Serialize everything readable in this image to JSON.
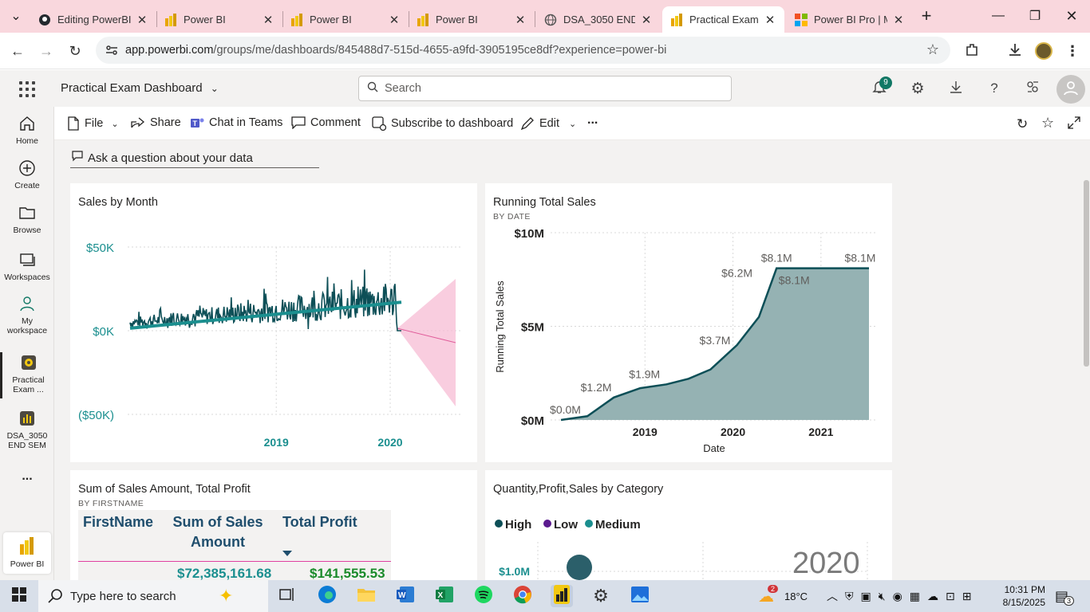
{
  "browser": {
    "tabs": [
      {
        "title": "Editing PowerBI_",
        "icon": "github-icon"
      },
      {
        "title": "Power BI",
        "icon": "powerbi-icon"
      },
      {
        "title": "Power BI",
        "icon": "powerbi-icon"
      },
      {
        "title": "Power BI",
        "icon": "powerbi-icon"
      },
      {
        "title": "DSA_3050 END S",
        "icon": "globe-icon"
      },
      {
        "title": "Practical Exam D",
        "icon": "powerbi-icon",
        "active": true
      },
      {
        "title": "Power BI Pro | M",
        "icon": "microsoft-icon"
      }
    ],
    "url_host": "app.powerbi.com",
    "url_path": "/groups/me/dashboards/845488d7-515d-4655-a9fd-3905195ce8df?experience=power-bi"
  },
  "header": {
    "dashboard_name": "Practical Exam Dashboard",
    "search_placeholder": "Search",
    "notification_count": "9"
  },
  "leftnav": {
    "home": "Home",
    "create": "Create",
    "browse": "Browse",
    "workspaces": "Workspaces",
    "my_workspace_1": "My",
    "my_workspace_2": "workspace",
    "practical_1": "Practical",
    "practical_2": "Exam ...",
    "dsa_1": "DSA_3050",
    "dsa_2": "END SEM",
    "more": "...",
    "powerbi": "Power BI"
  },
  "actionbar": {
    "file": "File",
    "share": "Share",
    "chat": "Chat in Teams",
    "comment": "Comment",
    "subscribe": "Subscribe to dashboard",
    "edit": "Edit",
    "more": "..."
  },
  "qa": {
    "placeholder": "Ask a question about your data"
  },
  "tiles": {
    "sales_by_month": {
      "title": "Sales by Month"
    },
    "running_total": {
      "title": "Running Total Sales",
      "subtitle": "BY DATE"
    },
    "sum_sales": {
      "title": "Sum of Sales Amount, Total Profit",
      "subtitle": "BY FIRSTNAME"
    },
    "qps": {
      "title": "Quantity,Profit,Sales by Category",
      "year": "2020"
    }
  },
  "table": {
    "headers": {
      "firstname": "FirstName",
      "sales_1": "Sum of Sales",
      "sales_2": "Amount",
      "profit": "Total Profit"
    },
    "row": {
      "sales": "$72,385,161.68",
      "profit": "$141,555.53"
    }
  },
  "chart_data": [
    {
      "type": "line",
      "title": "Sales by Month",
      "y_ticks": [
        "$50K",
        "$0K",
        "($50K)"
      ],
      "x_ticks": [
        "2019",
        "2020"
      ],
      "ylim": [
        -50000,
        50000
      ],
      "series": [
        {
          "values_summary": "noisy monthly sales line fluctuating roughly between $0K and $40K, with an upward trend line and a forecast cone afterwards"
        }
      ],
      "colors": {
        "line": "#0d4f57",
        "trend": "#1b8f8f",
        "forecast": "#f7b8d2"
      }
    },
    {
      "type": "area",
      "title": "Running Total Sales",
      "subtitle": "BY DATE",
      "xlabel": "Date",
      "ylabel": "Running Total Sales",
      "y_ticks": [
        "$10M",
        "$5M",
        "$0M"
      ],
      "x_ticks": [
        "2019",
        "2020",
        "2021"
      ],
      "ylim": [
        0,
        10000000
      ],
      "x": [
        2018.0,
        2018.3,
        2018.6,
        2018.9,
        2019.2,
        2019.45,
        2019.7,
        2020.0,
        2020.25,
        2020.45,
        2020.7,
        2021.0,
        2021.5
      ],
      "values": [
        0,
        200000,
        1200000,
        1700000,
        1900000,
        2200000,
        2700000,
        4000000,
        5500000,
        8100000,
        8100000,
        8100000,
        8100000
      ],
      "data_labels": [
        {
          "text": "$0.0M"
        },
        {
          "text": "$1.2M"
        },
        {
          "text": "$1.9M"
        },
        {
          "text": "$3.7M"
        },
        {
          "text": "$6.2M"
        },
        {
          "text": "$8.1M"
        },
        {
          "text": "$8.1M"
        },
        {
          "text": "$8.1M"
        }
      ],
      "colors": {
        "area": "#95b2b3",
        "line": "#0d4f57"
      }
    },
    {
      "type": "scatter",
      "title": "Quantity,Profit,Sales by Category",
      "legend": [
        {
          "name": "High",
          "color": "#0d4f57"
        },
        {
          "name": "Low",
          "color": "#5b1a8f"
        },
        {
          "name": "Medium",
          "color": "#1b8f8f"
        }
      ],
      "y_ticks": [
        "$1.0M"
      ],
      "play_axis_label": "2020"
    }
  ],
  "taskbar": {
    "search_placeholder": "Type here to search",
    "temperature": "18°C",
    "weather_badge": "2",
    "time": "10:31 PM",
    "date": "8/15/2025",
    "notif_count": "3"
  }
}
